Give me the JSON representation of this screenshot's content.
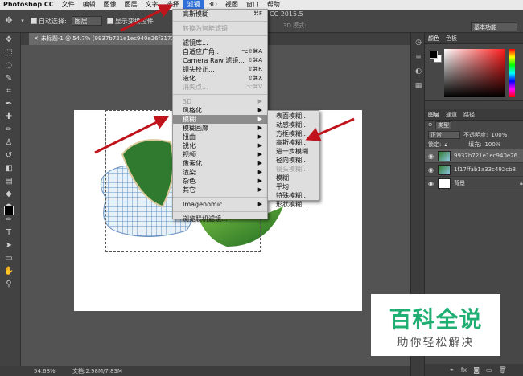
{
  "menubar": {
    "app": "Photoshop CC",
    "items": [
      "文件",
      "编辑",
      "图像",
      "图层",
      "文字",
      "选择",
      "滤镜",
      "3D",
      "视图",
      "窗口",
      "帮助"
    ],
    "active_index": 6
  },
  "options": {
    "auto_select_label": "自动选择:",
    "auto_select_value": "图层",
    "show_transform_label": "显示变换控件",
    "version": "CC 2015.5",
    "mode_3d": "3D 模式:",
    "workspace": "基本功能"
  },
  "document": {
    "tab_title": "未标题-1 @ 54.7% (9937b721e1ec940e26f31718083"
  },
  "status": {
    "zoom": "54.68%",
    "doc_size": "文档:2.98M/7.83M"
  },
  "filter_menu": {
    "items": [
      {
        "label": "高斯模糊",
        "shortcut": "⌘F"
      },
      {
        "sep": true
      },
      {
        "label": "转换为智能滤镜",
        "disabled": true
      },
      {
        "sep": true
      },
      {
        "label": "滤镜库..."
      },
      {
        "label": "自适应广角...",
        "shortcut": "⌥⇧⌘A"
      },
      {
        "label": "Camera Raw 滤镜...",
        "shortcut": "⇧⌘A"
      },
      {
        "label": "镜头校正...",
        "shortcut": "⇧⌘R"
      },
      {
        "label": "液化...",
        "shortcut": "⇧⌘X"
      },
      {
        "label": "消失点...",
        "shortcut": "⌥⌘V",
        "disabled": true
      },
      {
        "sep": true
      },
      {
        "label": "3D",
        "submenu": true,
        "disabled": true
      },
      {
        "label": "风格化",
        "submenu": true
      },
      {
        "label": "模糊",
        "submenu": true,
        "highlighted": true
      },
      {
        "label": "模糊画廊",
        "submenu": true
      },
      {
        "label": "扭曲",
        "submenu": true
      },
      {
        "label": "锐化",
        "submenu": true
      },
      {
        "label": "视频",
        "submenu": true
      },
      {
        "label": "像素化",
        "submenu": true
      },
      {
        "label": "渲染",
        "submenu": true
      },
      {
        "label": "杂色",
        "submenu": true
      },
      {
        "label": "其它",
        "submenu": true
      },
      {
        "sep": true
      },
      {
        "label": "Imagenomic",
        "submenu": true
      },
      {
        "sep": true
      },
      {
        "label": "浏览联机滤镜..."
      }
    ]
  },
  "blur_submenu": {
    "items": [
      {
        "label": "表面模糊..."
      },
      {
        "label": "动感模糊..."
      },
      {
        "label": "方框模糊..."
      },
      {
        "label": "高斯模糊..."
      },
      {
        "label": "进一步模糊"
      },
      {
        "label": "径向模糊..."
      },
      {
        "label": "镜头模糊...",
        "disabled": true
      },
      {
        "label": "模糊"
      },
      {
        "label": "平均"
      },
      {
        "label": "特殊模糊..."
      },
      {
        "label": "形状模糊..."
      }
    ]
  },
  "color_panel": {
    "tabs": [
      "颜色",
      "色板"
    ]
  },
  "layers_panel": {
    "tabs": [
      "图层",
      "通道",
      "路径"
    ],
    "kind_label": "类型",
    "blend_mode": "正常",
    "opacity_label": "不透明度:",
    "opacity_value": "100%",
    "lock_label": "锁定:",
    "fill_label": "填充:",
    "fill_value": "100%",
    "layers": [
      {
        "name": "9937b721e1ec940e26...",
        "active": true,
        "thumb": "image"
      },
      {
        "name": "1f17ffab1a33c492cb8...",
        "active": false,
        "thumb": "image"
      },
      {
        "name": "背景",
        "active": false,
        "thumb": "white",
        "locked": true
      }
    ]
  },
  "watermark": {
    "main": "百科全说",
    "sub": "助你轻松解决"
  },
  "colors": {
    "menu_bg": "#dedede",
    "highlight": "#8c8c8c",
    "arrow_red": "#c0141c",
    "watermark_green": "#1faf73"
  }
}
